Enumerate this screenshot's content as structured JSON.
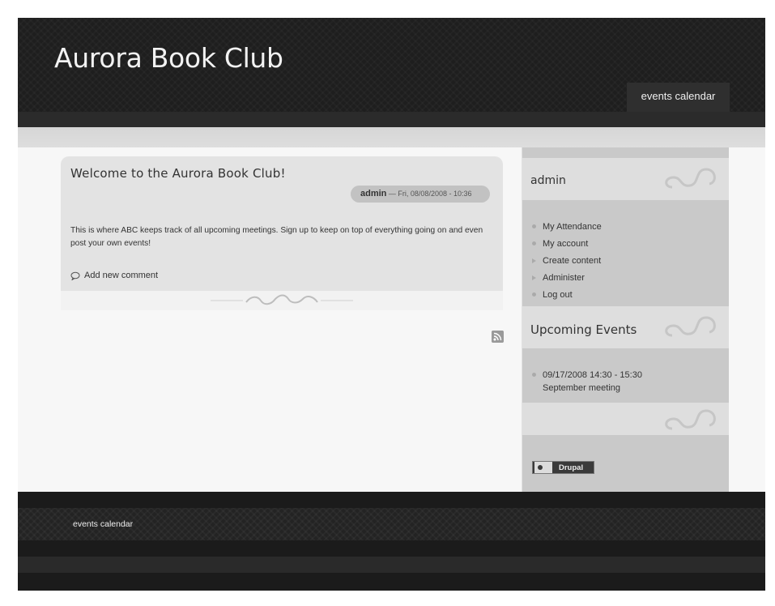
{
  "header": {
    "site_name": "Aurora Book Club",
    "nav_tab": "events calendar"
  },
  "node": {
    "title": "Welcome to the Aurora Book Club!",
    "author": "admin",
    "date": "— Fri, 08/08/2008 - 10:36",
    "body": "This is where ABC keeps track of all upcoming meetings. Sign up to keep on top of everything going on and even post your own events!",
    "add_comment": "Add new comment"
  },
  "sidebar": {
    "user_block": {
      "title": "admin",
      "items": [
        {
          "label": "My Attendance",
          "marker": "bullet"
        },
        {
          "label": "My account",
          "marker": "bullet"
        },
        {
          "label": "Create content",
          "marker": "arrow"
        },
        {
          "label": "Administer",
          "marker": "arrow"
        },
        {
          "label": "Log out",
          "marker": "bullet"
        }
      ]
    },
    "events_block": {
      "title": "Upcoming Events",
      "event_time": "09/17/2008 14:30 - 15:30",
      "event_name": "September meeting"
    },
    "powered_by": "Drupal"
  },
  "footer": {
    "link": "events calendar"
  },
  "icons": [
    "rss-feed-icon",
    "comment-icon",
    "drupal-logo-icon"
  ],
  "colors": {
    "header_bg": "#1e1e1e",
    "node_bg": "#e3e3e3",
    "sidebar_bg": "#c9c9c9"
  }
}
